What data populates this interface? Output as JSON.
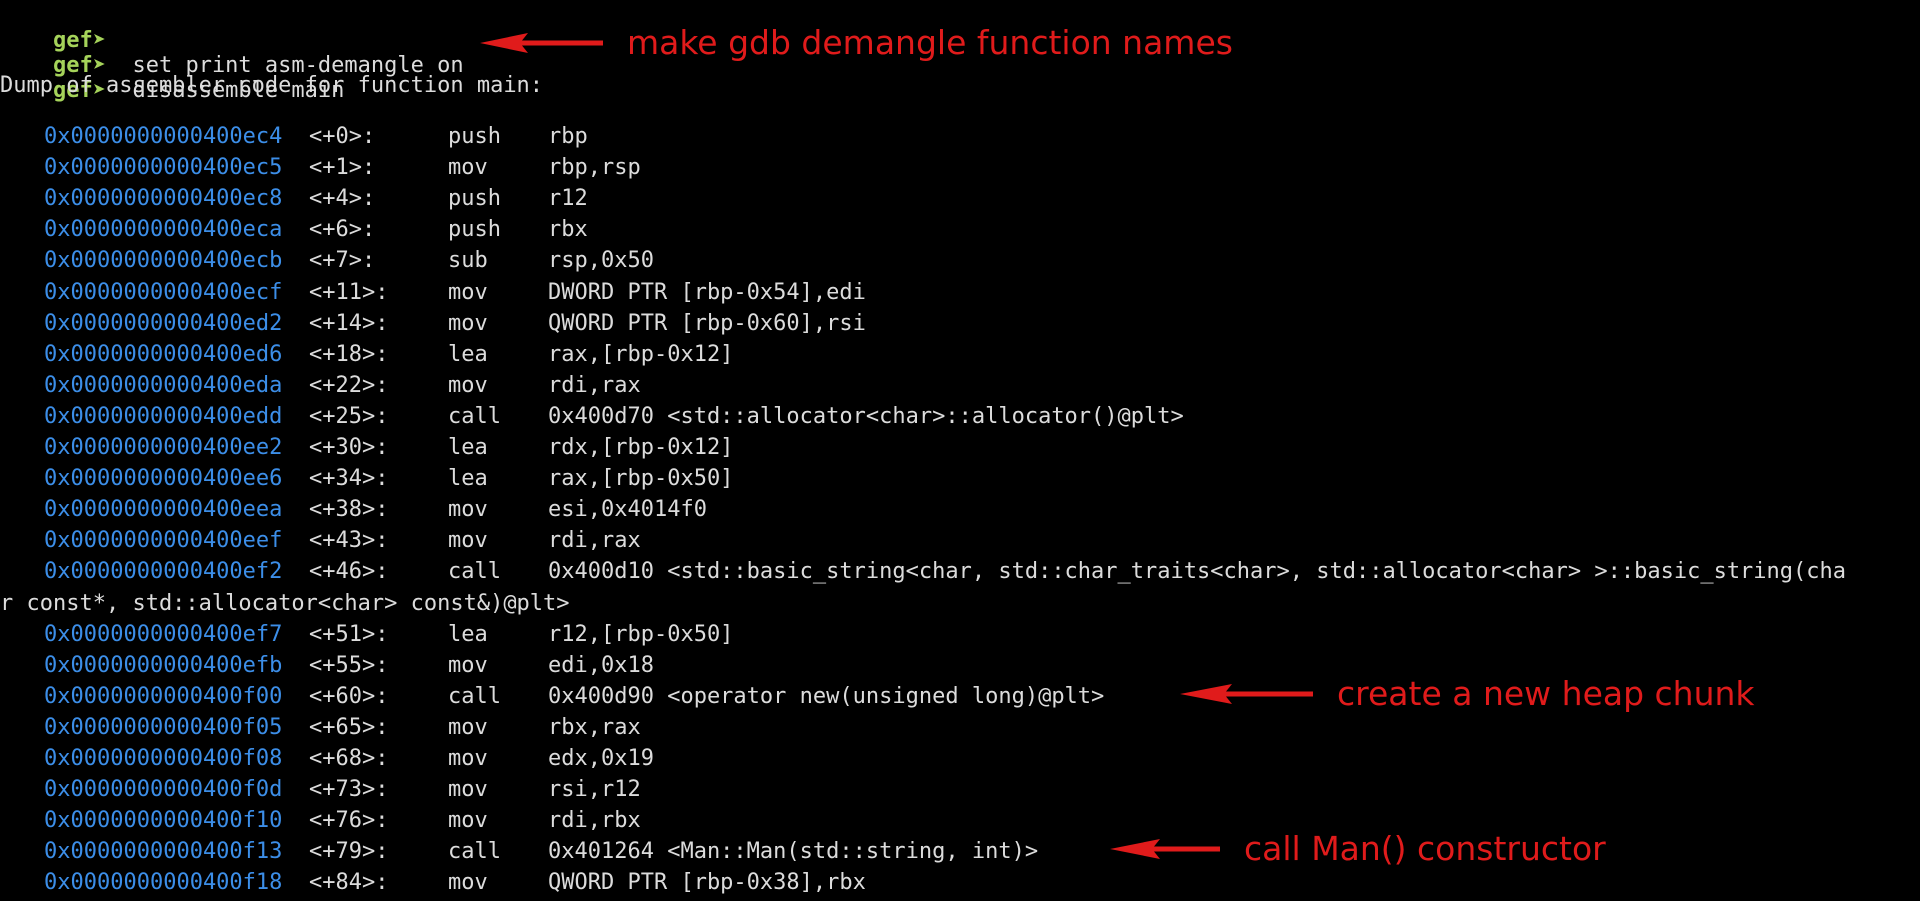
{
  "prompt": "gef➤",
  "commands": [
    "",
    "set print asm-demangle on",
    "disassemble main"
  ],
  "dump_header": "Dump of assembler code for function main:",
  "lines": [
    {
      "addr": "0x0000000000400ec4",
      "ofs": "<+0>:",
      "mnem": "push",
      "ops": "rbp"
    },
    {
      "addr": "0x0000000000400ec5",
      "ofs": "<+1>:",
      "mnem": "mov",
      "ops": "rbp,rsp"
    },
    {
      "addr": "0x0000000000400ec8",
      "ofs": "<+4>:",
      "mnem": "push",
      "ops": "r12"
    },
    {
      "addr": "0x0000000000400eca",
      "ofs": "<+6>:",
      "mnem": "push",
      "ops": "rbx"
    },
    {
      "addr": "0x0000000000400ecb",
      "ofs": "<+7>:",
      "mnem": "sub",
      "ops": "rsp,0x50"
    },
    {
      "addr": "0x0000000000400ecf",
      "ofs": "<+11>:",
      "mnem": "mov",
      "ops": "DWORD PTR [rbp-0x54],edi"
    },
    {
      "addr": "0x0000000000400ed2",
      "ofs": "<+14>:",
      "mnem": "mov",
      "ops": "QWORD PTR [rbp-0x60],rsi"
    },
    {
      "addr": "0x0000000000400ed6",
      "ofs": "<+18>:",
      "mnem": "lea",
      "ops": "rax,[rbp-0x12]"
    },
    {
      "addr": "0x0000000000400eda",
      "ofs": "<+22>:",
      "mnem": "mov",
      "ops": "rdi,rax"
    },
    {
      "addr": "0x0000000000400edd",
      "ofs": "<+25>:",
      "mnem": "call",
      "ops": "0x400d70 <std::allocator<char>::allocator()@plt>"
    },
    {
      "addr": "0x0000000000400ee2",
      "ofs": "<+30>:",
      "mnem": "lea",
      "ops": "rdx,[rbp-0x12]"
    },
    {
      "addr": "0x0000000000400ee6",
      "ofs": "<+34>:",
      "mnem": "lea",
      "ops": "rax,[rbp-0x50]"
    },
    {
      "addr": "0x0000000000400eea",
      "ofs": "<+38>:",
      "mnem": "mov",
      "ops": "esi,0x4014f0"
    },
    {
      "addr": "0x0000000000400eef",
      "ofs": "<+43>:",
      "mnem": "mov",
      "ops": "rdi,rax"
    },
    {
      "addr": "0x0000000000400ef2",
      "ofs": "<+46>:",
      "mnem": "call",
      "ops": "0x400d10 <std::basic_string<char, std::char_traits<char>, std::allocator<char> >::basic_string(cha"
    },
    {
      "wrap": "r const*, std::allocator<char> const&)@plt>"
    },
    {
      "addr": "0x0000000000400ef7",
      "ofs": "<+51>:",
      "mnem": "lea",
      "ops": "r12,[rbp-0x50]"
    },
    {
      "addr": "0x0000000000400efb",
      "ofs": "<+55>:",
      "mnem": "mov",
      "ops": "edi,0x18"
    },
    {
      "addr": "0x0000000000400f00",
      "ofs": "<+60>:",
      "mnem": "call",
      "ops": "0x400d90 <operator new(unsigned long)@plt>"
    },
    {
      "addr": "0x0000000000400f05",
      "ofs": "<+65>:",
      "mnem": "mov",
      "ops": "rbx,rax"
    },
    {
      "addr": "0x0000000000400f08",
      "ofs": "<+68>:",
      "mnem": "mov",
      "ops": "edx,0x19"
    },
    {
      "addr": "0x0000000000400f0d",
      "ofs": "<+73>:",
      "mnem": "mov",
      "ops": "rsi,r12"
    },
    {
      "addr": "0x0000000000400f10",
      "ofs": "<+76>:",
      "mnem": "mov",
      "ops": "rdi,rbx"
    },
    {
      "addr": "0x0000000000400f13",
      "ofs": "<+79>:",
      "mnem": "call",
      "ops": "0x401264 <Man::Man(std::string, int)>"
    },
    {
      "addr": "0x0000000000400f18",
      "ofs": "<+84>:",
      "mnem": "mov",
      "ops": "QWORD PTR [rbp-0x38],rbx"
    }
  ],
  "annotations": [
    {
      "text": "make gdb demangle function names"
    },
    {
      "text": "create a new heap chunk"
    },
    {
      "text": "call Man() constructor"
    }
  ],
  "colors": {
    "background": "#000000",
    "prompt": "#a5d35a",
    "address": "#3c8ee8",
    "text": "#dcdcdc",
    "annotation": "#e01b1b"
  }
}
